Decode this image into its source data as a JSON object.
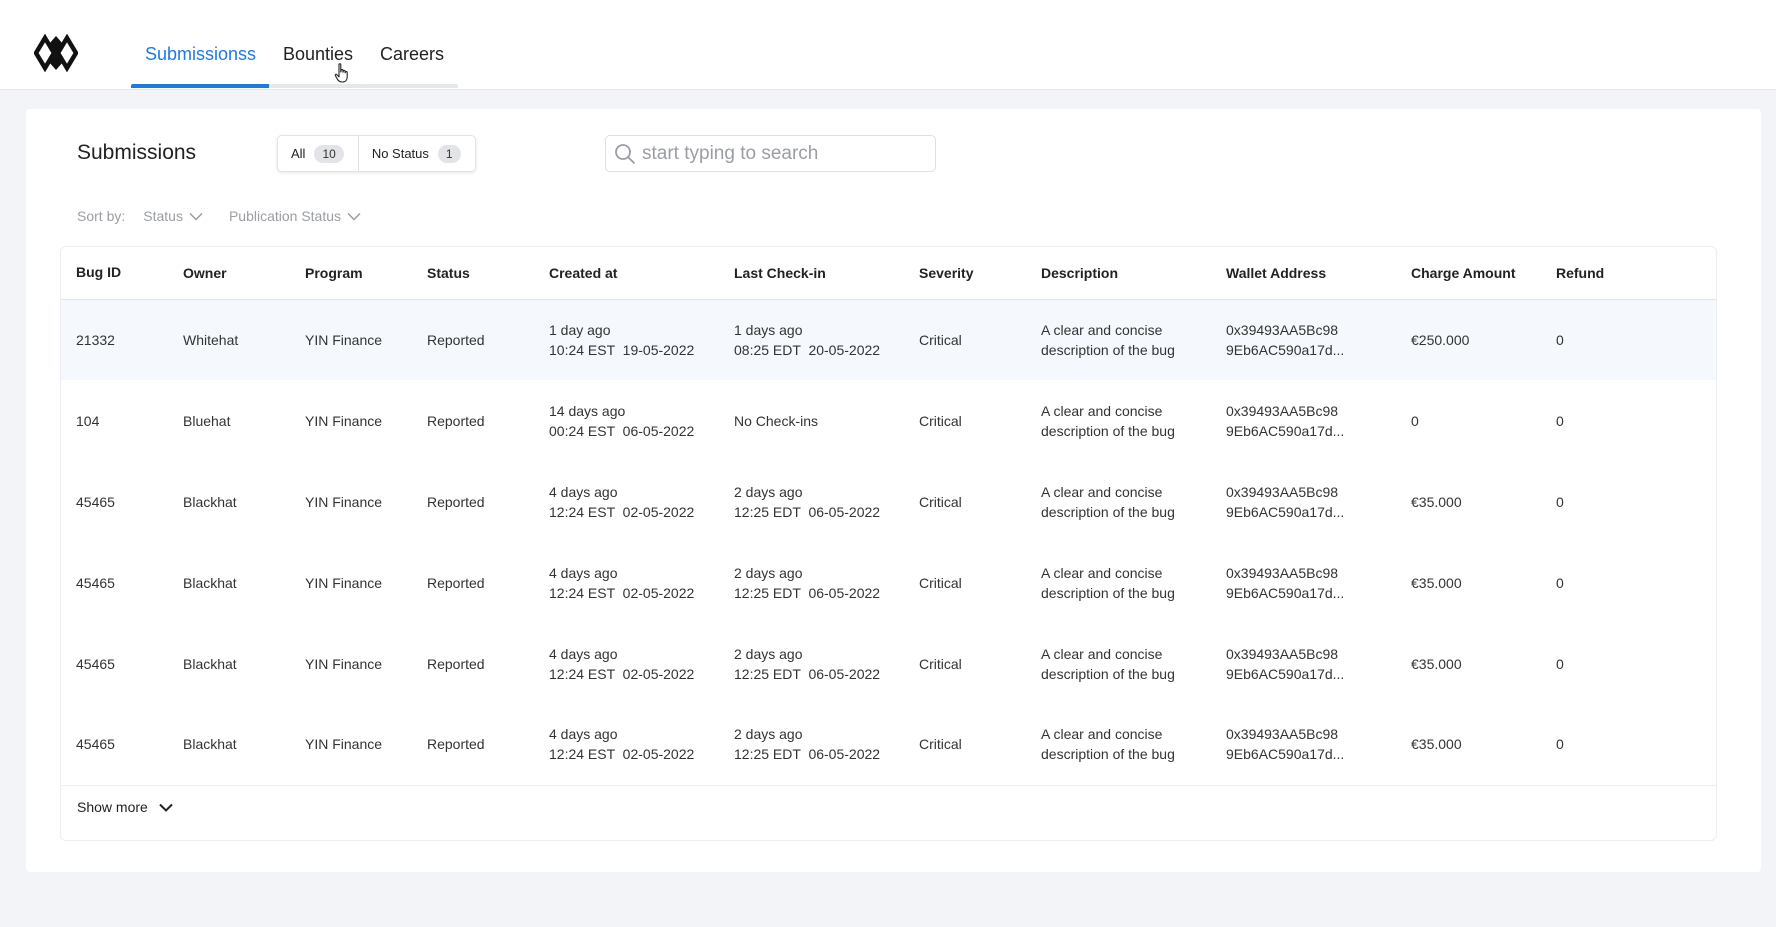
{
  "nav": {
    "tabs": [
      {
        "label": "Submissionss",
        "active": true
      },
      {
        "label": "Bounties",
        "active": false
      },
      {
        "label": "Careers",
        "active": false
      }
    ]
  },
  "page": {
    "title": "Submissions"
  },
  "filters": [
    {
      "label": "All",
      "count": "10"
    },
    {
      "label": "No Status",
      "count": "1"
    }
  ],
  "search": {
    "placeholder": "start typing to search",
    "value": ""
  },
  "sort": {
    "label": "Sort by:",
    "options": [
      "Status",
      "Publication Status"
    ]
  },
  "table": {
    "columns": [
      "Bug ID",
      "Owner",
      "Program",
      "Status",
      "Created at",
      "Last Check-in",
      "Severity",
      "Description",
      "Wallet Address",
      "Charge Amount",
      "Refund"
    ],
    "rows": [
      {
        "bug_id": "21332",
        "owner": "Whitehat",
        "program": "YIN Finance",
        "status": "Reported",
        "created_rel": "1 day ago",
        "created_abs": "10:24 EST  19-05-2022",
        "checkin_rel": "1 days ago",
        "checkin_abs": "08:25 EDT  20-05-2022",
        "severity": "Critical",
        "desc_1": "A clear and concise",
        "desc_2": "description of the bug",
        "wallet_1": "0x39493AA5Bc98",
        "wallet_2": "9Eb6AC590a17d...",
        "charge": "€250.000",
        "refund": "0"
      },
      {
        "bug_id": "104",
        "owner": "Bluehat",
        "program": "YIN Finance",
        "status": "Reported",
        "created_rel": "14 days ago",
        "created_abs": "00:24 EST  06-05-2022",
        "checkin_rel": "No Check-ins",
        "checkin_abs": "",
        "severity": "Critical",
        "desc_1": "A clear and concise",
        "desc_2": "description of the bug",
        "wallet_1": "0x39493AA5Bc98",
        "wallet_2": "9Eb6AC590a17d...",
        "charge": "0",
        "refund": "0"
      },
      {
        "bug_id": "45465",
        "owner": "Blackhat",
        "program": "YIN Finance",
        "status": "Reported",
        "created_rel": "4 days ago",
        "created_abs": "12:24 EST  02-05-2022",
        "checkin_rel": "2 days ago",
        "checkin_abs": "12:25 EDT  06-05-2022",
        "severity": "Critical",
        "desc_1": "A clear and concise",
        "desc_2": "description of the bug",
        "wallet_1": "0x39493AA5Bc98",
        "wallet_2": "9Eb6AC590a17d...",
        "charge": "€35.000",
        "refund": "0"
      },
      {
        "bug_id": "45465",
        "owner": "Blackhat",
        "program": "YIN Finance",
        "status": "Reported",
        "created_rel": "4 days ago",
        "created_abs": "12:24 EST  02-05-2022",
        "checkin_rel": "2 days ago",
        "checkin_abs": "12:25 EDT  06-05-2022",
        "severity": "Critical",
        "desc_1": "A clear and concise",
        "desc_2": "description of the bug",
        "wallet_1": "0x39493AA5Bc98",
        "wallet_2": "9Eb6AC590a17d...",
        "charge": "€35.000",
        "refund": "0"
      },
      {
        "bug_id": "45465",
        "owner": "Blackhat",
        "program": "YIN Finance",
        "status": "Reported",
        "created_rel": "4 days ago",
        "created_abs": "12:24 EST  02-05-2022",
        "checkin_rel": "2 days ago",
        "checkin_abs": "12:25 EDT  06-05-2022",
        "severity": "Critical",
        "desc_1": "A clear and concise",
        "desc_2": "description of the bug",
        "wallet_1": "0x39493AA5Bc98",
        "wallet_2": "9Eb6AC590a17d...",
        "charge": "€35.000",
        "refund": "0"
      },
      {
        "bug_id": "45465",
        "owner": "Blackhat",
        "program": "YIN Finance",
        "status": "Reported",
        "created_rel": "4 days ago",
        "created_abs": "12:24 EST  02-05-2022",
        "checkin_rel": "2 days ago",
        "checkin_abs": "12:25 EDT  06-05-2022",
        "severity": "Critical",
        "desc_1": "A clear and concise",
        "desc_2": "description of the bug",
        "wallet_1": "0x39493AA5Bc98",
        "wallet_2": "9Eb6AC590a17d...",
        "charge": "€35.000",
        "refund": "0"
      }
    ],
    "show_more": "Show more"
  },
  "icons": {
    "logo": "logo-icon",
    "search": "search-icon",
    "chevron": "chevron-down-icon",
    "cursor": "hand-cursor-icon"
  },
  "colors": {
    "accent": "#1f7ae0",
    "row_highlight": "#f5f9fd",
    "background": "#f3f4f7"
  }
}
